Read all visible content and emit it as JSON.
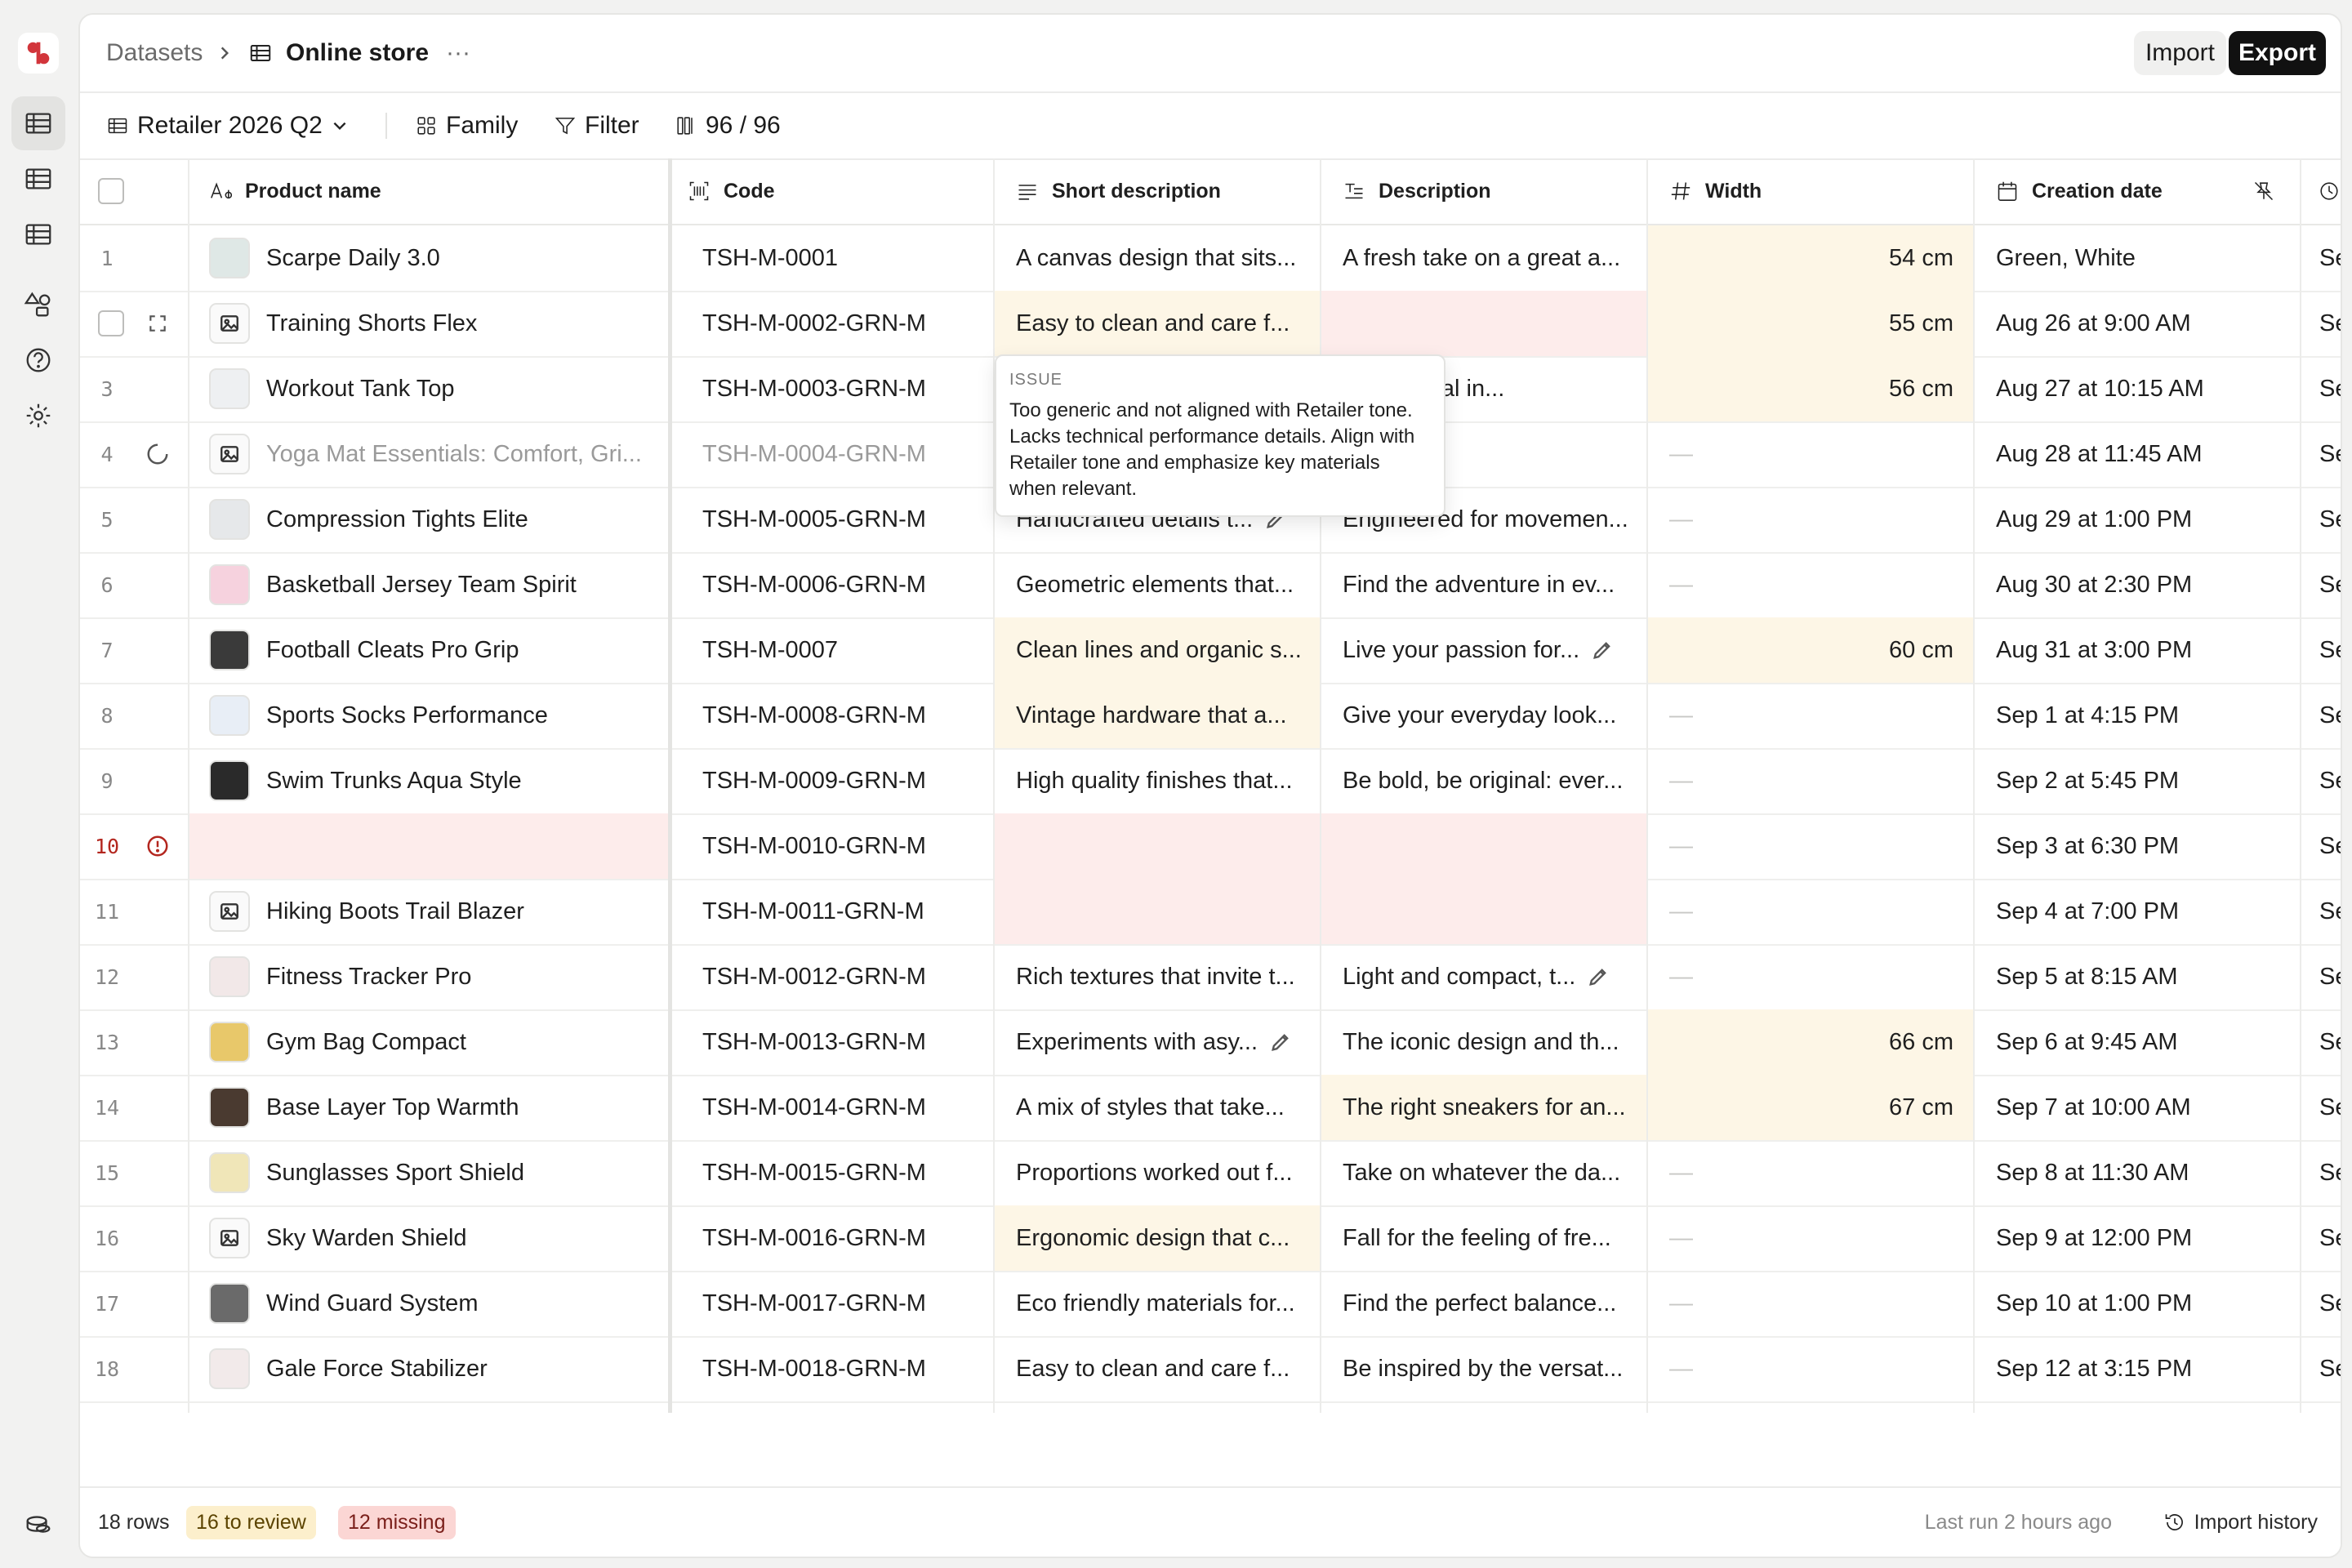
{
  "colors": {
    "accent": "#d2353b",
    "review_bg": "#fdf6e6",
    "missing_bg": "#fdeceb",
    "error": "#b3261e"
  },
  "breadcrumb": {
    "root": "Datasets",
    "current": "Online store",
    "more": "···"
  },
  "header": {
    "import_label": "Import",
    "export_label": "Export"
  },
  "toolbar": {
    "view_label": "Retailer 2026 Q2",
    "family_label": "Family",
    "filter_label": "Filter",
    "columns_label": "96 / 96"
  },
  "columns": {
    "product_name": "Product name",
    "code": "Code",
    "short_description": "Short description",
    "description": "Description",
    "width": "Width",
    "creation_date": "Creation date"
  },
  "rows": [
    {
      "num": "1",
      "name": "Scarpe Daily 3.0",
      "code": "TSH-M-0001",
      "short": "A canvas design that sits...",
      "desc": "A fresh take on a great a...",
      "width": "54 cm",
      "date": "Green, White",
      "next": "Se"
    },
    {
      "num": "2",
      "name": "Training Shorts Flex",
      "code": "TSH-M-0002-GRN-M",
      "short": "Easy to clean and care f...",
      "desc": "",
      "width": "55 cm",
      "date": "Aug 26 at 9:00 AM",
      "next": "Se"
    },
    {
      "num": "3",
      "name": "Workout Tank Top",
      "code": "TSH-M-0003-GRN-M",
      "short": "",
      "desc": "ur potential in...",
      "width": "56 cm",
      "date": "Aug 27 at 10:15 AM",
      "next": "Se"
    },
    {
      "num": "4",
      "name": "Yoga Mat Essentials: Comfort, Gri...",
      "code": "TSH-M-0004-GRN-M",
      "short": "",
      "desc": ".",
      "width": "—",
      "date": "Aug 28 at 11:45 AM",
      "next": "Se"
    },
    {
      "num": "5",
      "name": "Compression Tights Elite",
      "code": "TSH-M-0005-GRN-M",
      "short": "Handcrafted details t...",
      "desc": "Engineered for movemen...",
      "width": "—",
      "date": "Aug 29 at 1:00 PM",
      "next": "Se"
    },
    {
      "num": "6",
      "name": "Basketball Jersey Team Spirit",
      "code": "TSH-M-0006-GRN-M",
      "short": "Geometric elements that...",
      "desc": "Find the adventure in ev...",
      "width": "—",
      "date": "Aug 30 at 2:30 PM",
      "next": "Se"
    },
    {
      "num": "7",
      "name": "Football Cleats Pro Grip",
      "code": "TSH-M-0007",
      "short": "Clean lines and organic s...",
      "desc": "Live your passion for...",
      "width": "60 cm",
      "date": "Aug 31 at 3:00 PM",
      "next": "Se"
    },
    {
      "num": "8",
      "name": "Sports Socks Performance",
      "code": "TSH-M-0008-GRN-M",
      "short": "Vintage hardware that a...",
      "desc": "Give your everyday look...",
      "width": "—",
      "date": "Sep 1 at 4:15 PM",
      "next": "Se"
    },
    {
      "num": "9",
      "name": "Swim Trunks Aqua Style",
      "code": "TSH-M-0009-GRN-M",
      "short": "High quality finishes that...",
      "desc": "Be bold, be original: ever...",
      "width": "—",
      "date": "Sep 2 at 5:45 PM",
      "next": "Se"
    },
    {
      "num": "10",
      "name": "",
      "code": "TSH-M-0010-GRN-M",
      "short": "",
      "desc": "",
      "width": "—",
      "date": "Sep 3 at 6:30 PM",
      "next": "Se"
    },
    {
      "num": "11",
      "name": "Hiking Boots Trail Blazer",
      "code": "TSH-M-0011-GRN-M",
      "short": "",
      "desc": "",
      "width": "—",
      "date": "Sep 4 at 7:00 PM",
      "next": "Se"
    },
    {
      "num": "12",
      "name": "Fitness Tracker Pro",
      "code": "TSH-M-0012-GRN-M",
      "short": "Rich textures that invite t...",
      "desc": "Light and compact, t...",
      "width": "—",
      "date": "Sep 5 at 8:15 AM",
      "next": "Se"
    },
    {
      "num": "13",
      "name": "Gym Bag Compact",
      "code": "TSH-M-0013-GRN-M",
      "short": "Experiments with asy...",
      "desc": "The iconic design and th...",
      "width": "66 cm",
      "date": "Sep 6 at 9:45 AM",
      "next": "Se"
    },
    {
      "num": "14",
      "name": "Base Layer Top Warmth",
      "code": "TSH-M-0014-GRN-M",
      "short": "A mix of styles that take...",
      "desc": "The right sneakers for an...",
      "width": "67 cm",
      "date": "Sep 7 at 10:00 AM",
      "next": "Se"
    },
    {
      "num": "15",
      "name": "Sunglasses Sport Shield",
      "code": "TSH-M-0015-GRN-M",
      "short": "Proportions worked out f...",
      "desc": "Take on whatever the da...",
      "width": "—",
      "date": "Sep 8 at 11:30 AM",
      "next": "Se"
    },
    {
      "num": "16",
      "name": "Sky Warden Shield",
      "code": "TSH-M-0016-GRN-M",
      "short": "Ergonomic design that c...",
      "desc": "Fall for the feeling of fre...",
      "width": "—",
      "date": "Sep 9 at 12:00 PM",
      "next": "Se"
    },
    {
      "num": "17",
      "name": "Wind Guard System",
      "code": "TSH-M-0017-GRN-M",
      "short": "Eco friendly materials for...",
      "desc": "Find the perfect balance...",
      "width": "—",
      "date": "Sep 10 at 1:00 PM",
      "next": "Se"
    },
    {
      "num": "18",
      "name": "Gale Force Stabilizer",
      "code": "TSH-M-0018-GRN-M",
      "short": "Easy to clean and care f...",
      "desc": "Be inspired by the versat...",
      "width": "—",
      "date": "Sep 12 at 3:15 PM",
      "next": "Se"
    }
  ],
  "tooltip": {
    "title": "ISSUE",
    "body": "Too generic and not aligned with Retailer tone. Lacks technical performance details. Align with Retailer tone and emphasize key materials when relevant."
  },
  "footer": {
    "rows": "18 rows",
    "review": "16 to review",
    "missing": "12 missing",
    "last_run": "Last run 2 hours ago",
    "history": "Import history"
  }
}
